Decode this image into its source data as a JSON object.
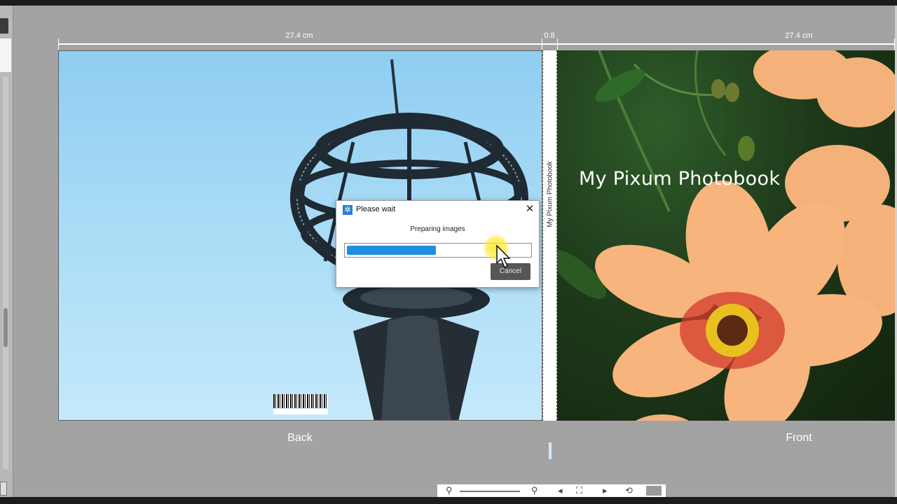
{
  "ruler": {
    "back_width": "27.4 cm",
    "spine_width": "0.8",
    "front_width": "27.4 cm"
  },
  "cover": {
    "front_title": "My Pixum Photobook",
    "spine_text": "My Pixum Photobook",
    "back_caption": "Back",
    "front_caption": "Front"
  },
  "dialog": {
    "title": "Please wait",
    "message": "Preparing images",
    "progress_fraction": 0.49,
    "cancel_label": "Cancel",
    "close_icon": "close-icon",
    "app_icon": "gear-icon"
  },
  "toolbar": {
    "icons": [
      "zoom-out-icon",
      "zoom-in-icon",
      "previous-icon",
      "fit-page-icon",
      "next-icon",
      "rotate-icon",
      "view-mode-icon"
    ]
  },
  "colors": {
    "progress": "#1e8fdc",
    "background": "#a3a3a3",
    "highlight": "#ffe828"
  }
}
